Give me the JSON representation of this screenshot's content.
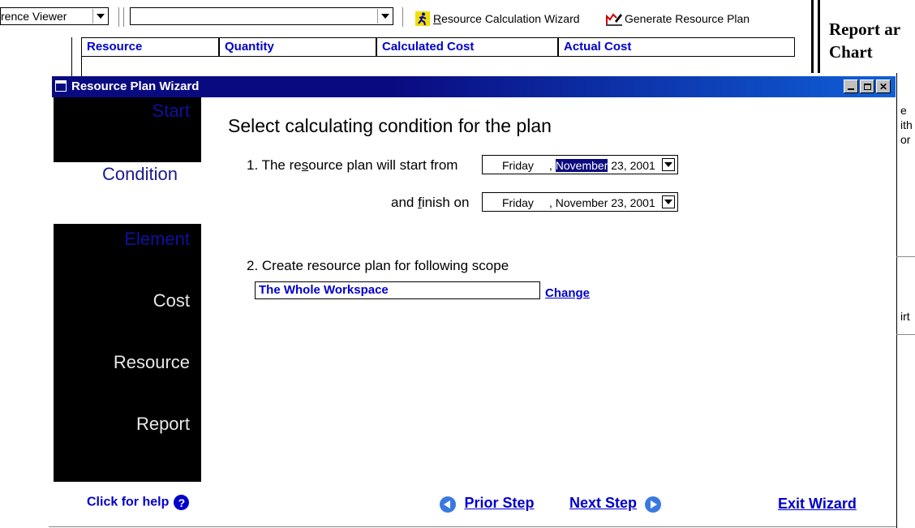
{
  "toolbar": {
    "viewer_combo": "rence Viewer",
    "second_combo": "",
    "wizard_button": "Resource Calculation Wizard",
    "wizard_button_accel": "R",
    "generate_button": "Generate Resource Plan"
  },
  "table_header": {
    "columns": [
      "Resource",
      "Quantity",
      "Calculated Cost",
      "Actual Cost"
    ]
  },
  "right_panel": {
    "title_line1": "Report ar",
    "title_line2": "Chart",
    "fragments": [
      "e",
      "ith",
      "or",
      "irt"
    ]
  },
  "wizard": {
    "window_title": "Resource Plan Wizard",
    "nav": {
      "start": "Start",
      "condition": "Condition",
      "element": "Element",
      "cost": "Cost",
      "resource": "Resource",
      "report": "Report"
    },
    "heading": "Select calculating condition for the plan",
    "start_label": "1. The resource plan will start from",
    "start_label_accel": "s",
    "start_date": {
      "day": "Friday",
      "month": "November",
      "rest": " 23, 2001"
    },
    "finish_label": "and finish on",
    "finish_label_accel": "f",
    "finish_date": {
      "day": "Friday",
      "text": ", November 23, 2001"
    },
    "scope_label": "2. Create resource plan for following scope",
    "scope_value": "The Whole Workspace",
    "change_link": "Change",
    "help_link": "Click for help",
    "prior_step": "Prior Step",
    "next_step": "Next Step",
    "exit_wizard": "Exit Wizard"
  },
  "colors": {
    "title_bar": "#0a0a80",
    "link": "#0000cc",
    "nav_background": "#000000"
  }
}
